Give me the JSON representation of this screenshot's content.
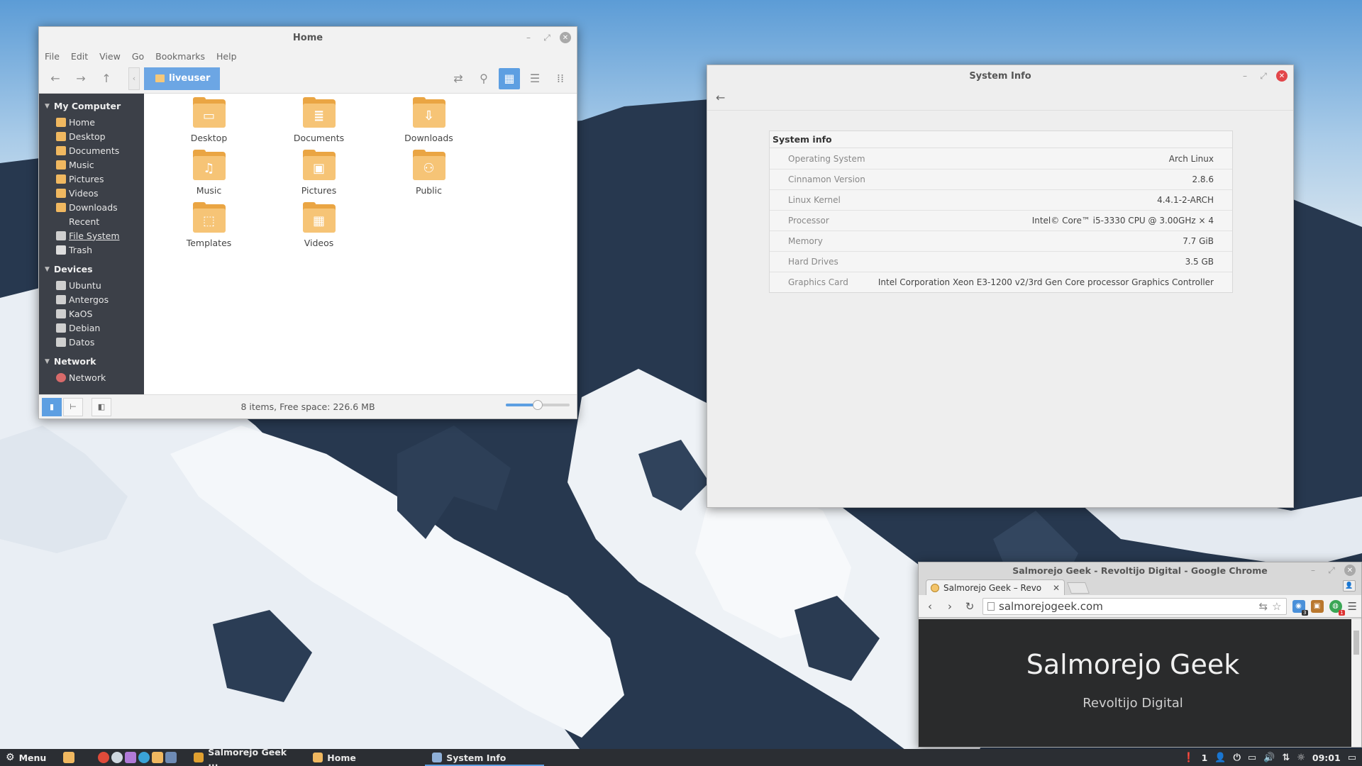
{
  "file_manager": {
    "title": "Home",
    "menu": [
      "File",
      "Edit",
      "View",
      "Go",
      "Bookmarks",
      "Help"
    ],
    "path_button": "liveuser",
    "sidebar": {
      "my_computer": {
        "heading": "My Computer",
        "items": [
          {
            "label": "Home",
            "icon": "home-folder-icon"
          },
          {
            "label": "Desktop",
            "icon": "desktop-folder-icon"
          },
          {
            "label": "Documents",
            "icon": "documents-folder-icon"
          },
          {
            "label": "Music",
            "icon": "music-folder-icon"
          },
          {
            "label": "Pictures",
            "icon": "pictures-folder-icon"
          },
          {
            "label": "Videos",
            "icon": "videos-folder-icon"
          },
          {
            "label": "Downloads",
            "icon": "downloads-folder-icon"
          },
          {
            "label": "Recent",
            "icon": "recent-icon"
          },
          {
            "label": "File System",
            "icon": "filesystem-icon"
          },
          {
            "label": "Trash",
            "icon": "trash-icon"
          }
        ]
      },
      "devices": {
        "heading": "Devices",
        "items": [
          "Ubuntu",
          "Antergos",
          "KaOS",
          "Debian",
          "Datos"
        ]
      },
      "network": {
        "heading": "Network",
        "items": [
          "Network"
        ]
      }
    },
    "files": [
      {
        "name": "Desktop",
        "glyph": "▭"
      },
      {
        "name": "Documents",
        "glyph": "≣"
      },
      {
        "name": "Downloads",
        "glyph": "⇩"
      },
      {
        "name": "Music",
        "glyph": "♫"
      },
      {
        "name": "Pictures",
        "glyph": "▣"
      },
      {
        "name": "Public",
        "glyph": "⚇"
      },
      {
        "name": "Templates",
        "glyph": "⬚"
      },
      {
        "name": "Videos",
        "glyph": "▦"
      }
    ],
    "status": "8 items, Free space: 226.6 MB",
    "zoom_level": 0.5
  },
  "system_info": {
    "title": "System Info",
    "caption": "System info",
    "rows": [
      {
        "key": "Operating System",
        "value": "Arch Linux"
      },
      {
        "key": "Cinnamon Version",
        "value": "2.8.6"
      },
      {
        "key": "Linux Kernel",
        "value": "4.4.1-2-ARCH"
      },
      {
        "key": "Processor",
        "value": "Intel© Core™ i5-3330 CPU @ 3.00GHz × 4"
      },
      {
        "key": "Memory",
        "value": "7.7 GiB"
      },
      {
        "key": "Hard Drives",
        "value": "3.5 GB"
      },
      {
        "key": "Graphics Card",
        "value": "Intel Corporation Xeon E3-1200 v2/3rd Gen Core processor Graphics Controller"
      }
    ]
  },
  "chrome": {
    "title": "Salmorejo Geek - Revoltijo Digital - Google Chrome",
    "tab_title": "Salmorejo Geek – Revo",
    "url": "salmorejogeek.com",
    "site_title": "Salmorejo Geek",
    "site_subtitle": "Revoltijo Digital",
    "ext_badges": [
      "3",
      "1"
    ]
  },
  "panel": {
    "menu_label": "Menu",
    "tasks": [
      {
        "label": "Salmorejo Geek ...",
        "color": "#e0a030"
      },
      {
        "label": "Home",
        "color": "#f0b860"
      },
      {
        "label": "System Info",
        "color": "#8fb0d8"
      }
    ],
    "tray_count": "1",
    "clock": "09:01"
  },
  "colors": {
    "accent": "#5d9fe2",
    "folder": "#f6c476",
    "close_red": "#e2464a",
    "sidebar_bg": "#3c4048"
  }
}
